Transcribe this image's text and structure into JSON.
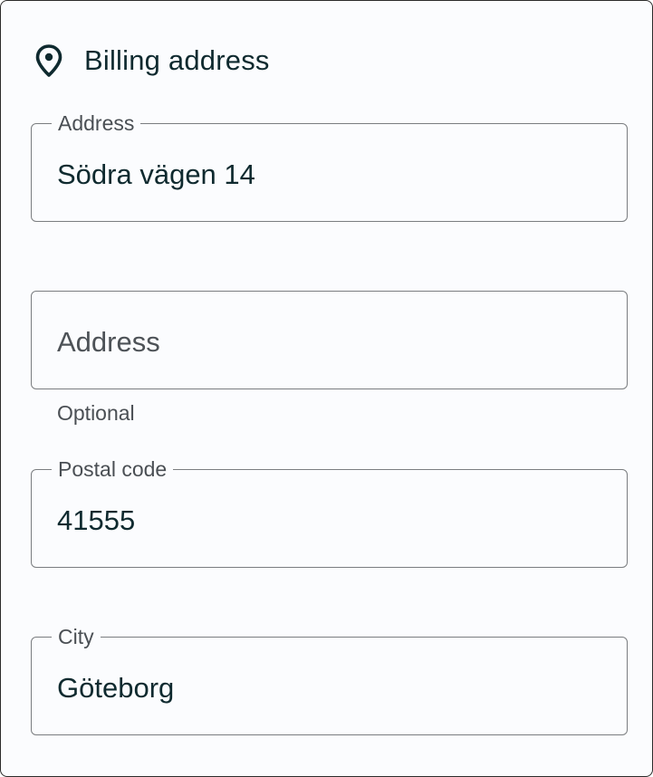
{
  "section": {
    "title": "Billing address",
    "icon": "location-pin-icon"
  },
  "fields": {
    "address1": {
      "label": "Address",
      "value": "Södra vägen 14"
    },
    "address2": {
      "placeholder": "Address",
      "helper": "Optional"
    },
    "postal_code": {
      "label": "Postal code",
      "value": "41555"
    },
    "city": {
      "label": "City",
      "value": "Göteborg"
    }
  },
  "colors": {
    "text": "#0f2a2f",
    "border": "#7a7d80",
    "background": "#fbfcfe"
  }
}
